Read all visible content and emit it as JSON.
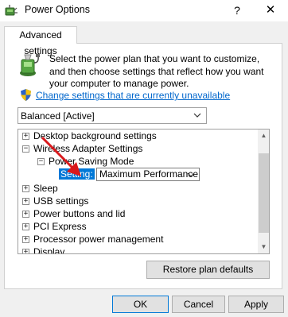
{
  "window": {
    "title": "Power Options",
    "help_glyph": "?",
    "close_glyph": "✕"
  },
  "tab": {
    "label": "Advanced settings"
  },
  "intro_text": "Select the power plan that you want to customize, and then choose settings that reflect how you want your computer to manage power.",
  "change_link": "Change settings that are currently unavailable",
  "plan_select": {
    "value": "Balanced [Active]"
  },
  "tree": {
    "items": [
      {
        "label": "Desktop background settings",
        "expander": "+"
      },
      {
        "label": "Wireless Adapter Settings",
        "expander": "−"
      },
      {
        "label": "Power Saving Mode",
        "expander": "−"
      },
      {
        "label": "Sleep",
        "expander": "+"
      },
      {
        "label": "USB settings",
        "expander": "+"
      },
      {
        "label": "Power buttons and lid",
        "expander": "+"
      },
      {
        "label": "PCI Express",
        "expander": "+"
      },
      {
        "label": "Processor power management",
        "expander": "+"
      },
      {
        "label": "Display",
        "expander": "+"
      }
    ],
    "setting_label": "Setting:",
    "setting_value": "Maximum Performance"
  },
  "buttons": {
    "restore": "Restore plan defaults",
    "ok": "OK",
    "cancel": "Cancel",
    "apply": "Apply"
  },
  "colors": {
    "accent": "#0078d7",
    "link": "#0066cc",
    "annotation_arrow": "#d9191c"
  }
}
